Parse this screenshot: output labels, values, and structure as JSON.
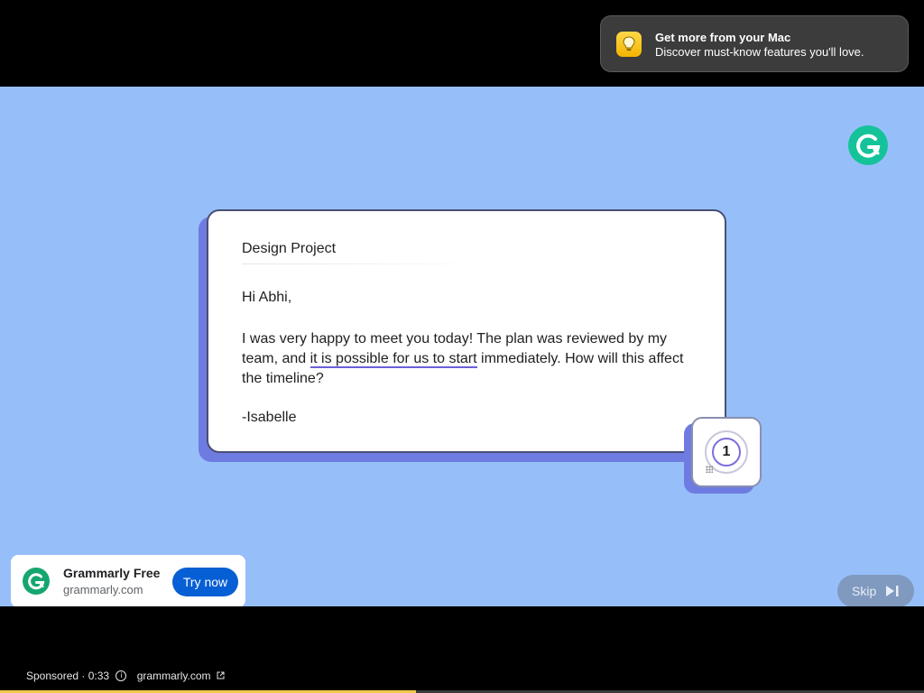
{
  "notification": {
    "title": "Get more from your Mac",
    "body": "Discover must-know features you'll love.",
    "icon": "lightbulb-icon"
  },
  "email": {
    "subject": "Design Project",
    "greeting": "Hi Abhi,",
    "body_before": "I was very happy to meet you today! The plan was reviewed by my team, and ",
    "body_highlight": "it is possible for us to start",
    "body_after": " immediately. How will this affect the timeline?",
    "signature": "-Isabelle"
  },
  "suggestion_badge": {
    "count": "1"
  },
  "ad": {
    "title": "Grammarly Free",
    "domain": "grammarly.com",
    "cta": "Try now"
  },
  "skip": {
    "label": "Skip"
  },
  "footer": {
    "sponsored": "Sponsored · 0:33",
    "domain": "grammarly.com"
  },
  "progress": {
    "fraction": 0.45
  },
  "colors": {
    "video_background": "#96bffa",
    "grammarly_green": "#15c39a",
    "cta_blue": "#065fd4",
    "progress_yellow": "#f2c94c"
  }
}
